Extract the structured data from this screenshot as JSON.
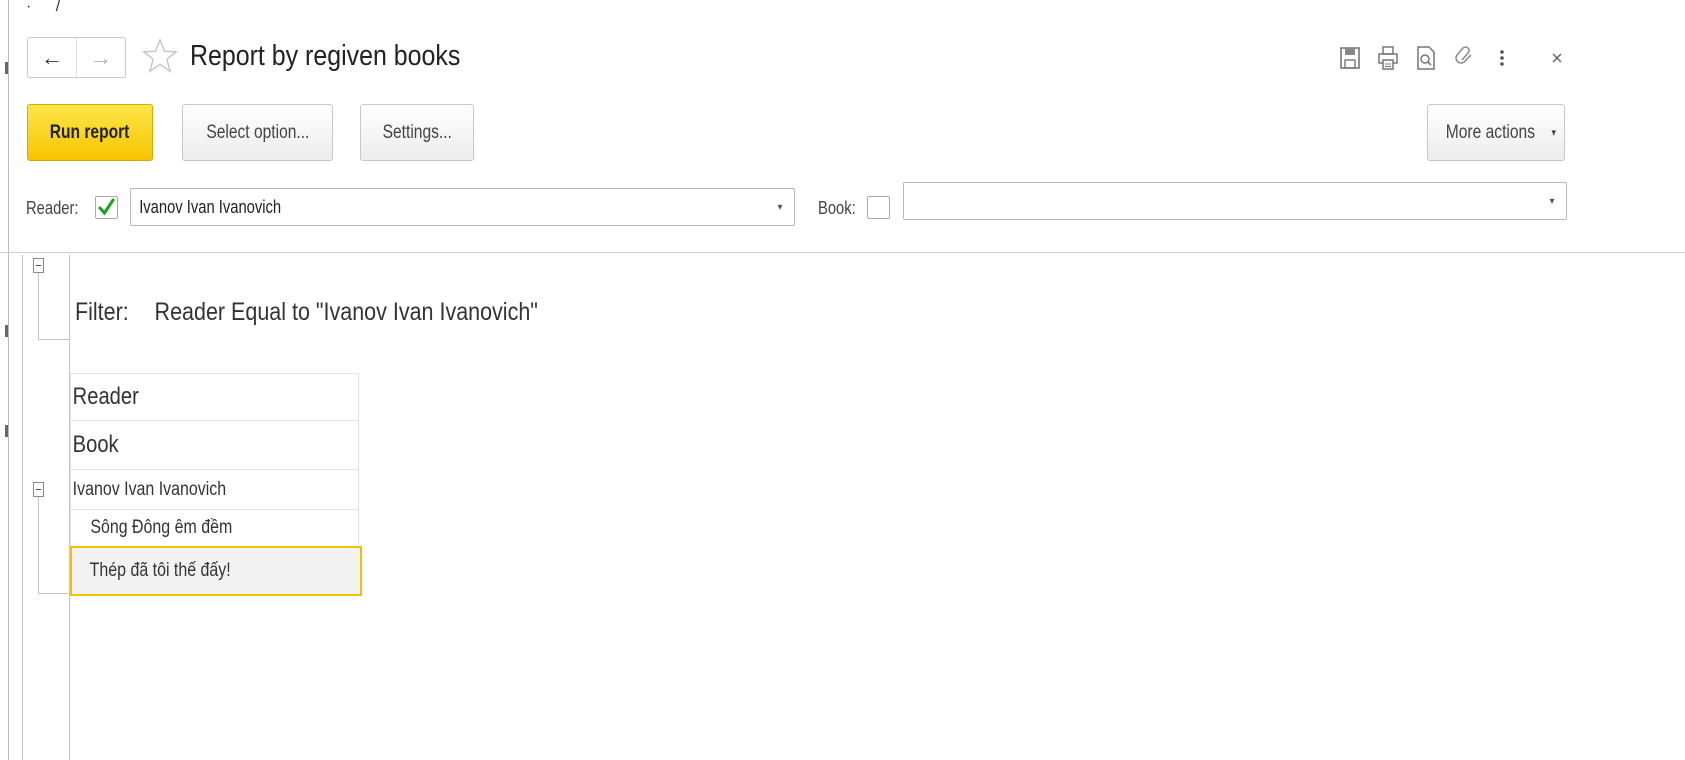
{
  "window": {
    "title": "Report by regiven books",
    "top_glyph": "· /"
  },
  "header_icons": [
    "save-icon",
    "print-icon",
    "preview-icon",
    "link-icon",
    "more-vertical-icon",
    "close-icon"
  ],
  "toolbar": {
    "run_label": "Run report",
    "select_option_label": "Select option...",
    "settings_label": "Settings...",
    "more_actions_label": "More actions",
    "more_actions_arrow": "▾"
  },
  "filters": {
    "reader_label": "Reader:",
    "reader_checked": true,
    "reader_value": "Ivanov Ivan Ivanovich",
    "book_label": "Book:",
    "book_checked": false,
    "book_value": "",
    "dropdown_arrow": "▾"
  },
  "report": {
    "filter_label": "Filter:",
    "filter_text": "Reader Equal to \"Ivanov Ivan Ivanovich\"",
    "column_headers": [
      "Reader",
      "Book"
    ],
    "group": {
      "reader": "Ivanov Ivan Ivanovich",
      "books": [
        "Sông Đông êm đềm",
        "Thép đã tôi thế đấy!"
      ]
    },
    "selected_row_index": 1
  },
  "colors": {
    "accent_yellow": "#f5c400",
    "selection_border": "#f2c200",
    "check_green": "#1aa31a"
  }
}
